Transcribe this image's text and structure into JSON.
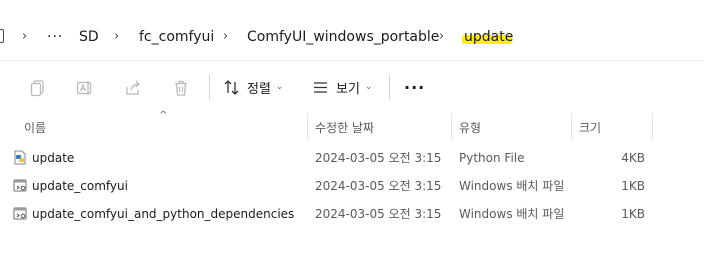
{
  "address_bar": {
    "overflow_label": "···",
    "crumbs": [
      "SD",
      "fc_comfyui",
      "ComfyUI_windows_portable"
    ],
    "current": "update",
    "chevron": "›",
    "highlight_color": "#fff000"
  },
  "toolbar": {
    "sort_label": "정렬",
    "view_label": "보기",
    "more_label": "···",
    "icons": [
      "copy-icon",
      "rename-icon",
      "share-icon",
      "delete-icon",
      "sort-icon",
      "view-icon",
      "more-icon"
    ]
  },
  "columns": {
    "name": "이름",
    "modified": "수정한 날짜",
    "type": "유형",
    "size": "크기"
  },
  "files": [
    {
      "name": "update",
      "modified": "2024-03-05 오전 3:15",
      "type": "Python File",
      "size": "4KB",
      "icon": "python-file-icon"
    },
    {
      "name": "update_comfyui",
      "modified": "2024-03-05 오전 3:15",
      "type": "Windows 배치 파일",
      "size": "1KB",
      "icon": "batch-file-icon"
    },
    {
      "name": "update_comfyui_and_python_dependencies",
      "modified": "2024-03-05 오전 3:15",
      "type": "Windows 배치 파일",
      "size": "1KB",
      "icon": "batch-file-icon"
    }
  ]
}
